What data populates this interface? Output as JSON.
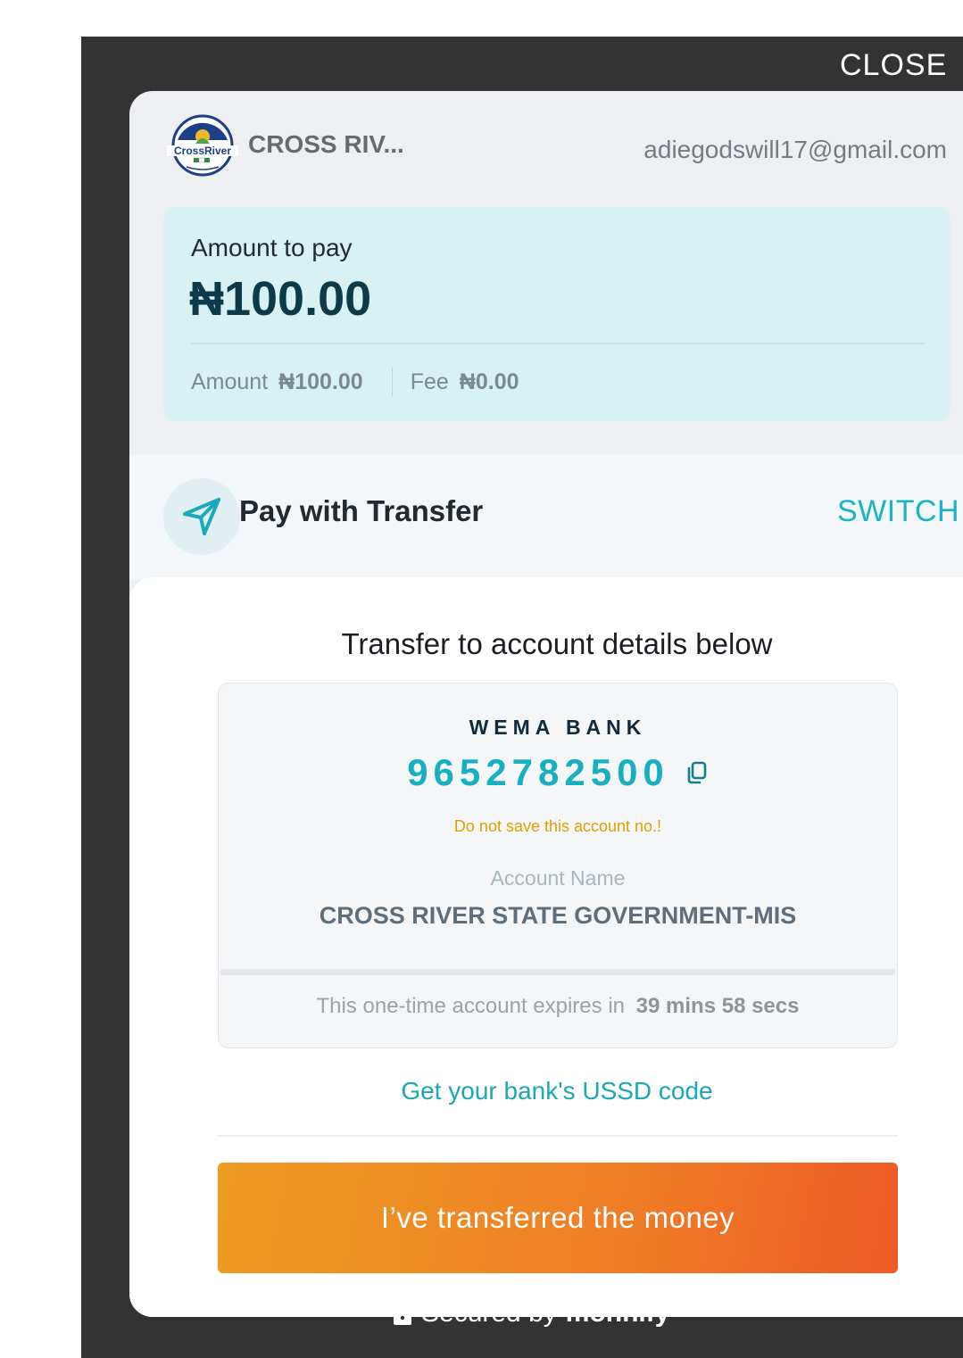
{
  "overlay": {
    "close_label": "CLOSE",
    "close_icon": "close-x-icon",
    "secured_prefix": "Secured by",
    "secured_brand": "monnify"
  },
  "header": {
    "merchant_name": "CROSS RIV...",
    "merchant_logo_text": "CrossRiver",
    "customer_email": "adiegodswill17@gmail.com"
  },
  "amount": {
    "label": "Amount to pay",
    "total": "₦100.00",
    "amount_label": "Amount",
    "amount_value": "₦100.00",
    "fee_label": "Fee",
    "fee_value": "₦0.00"
  },
  "method": {
    "icon": "send-icon",
    "title": "Pay with Transfer",
    "switch_label": "SWITCH"
  },
  "transfer": {
    "title": "Transfer to account details below",
    "bank_name": "WEMA BANK",
    "account_number": "9652782500",
    "copy_icon": "copy-icon",
    "warning": "Do not save this account no.!",
    "account_name_label": "Account Name",
    "account_name": "CROSS RIVER STATE GOVERNMENT-MIS",
    "expiry_text": "This one-time account expires in",
    "expiry_time": "39 mins 58 secs",
    "ussd_link": "Get your bank's USSD code",
    "confirm_button": "I’ve transferred the money"
  },
  "colors": {
    "accent": "#1ab4c3",
    "warning": "#e0a100",
    "button_start": "#ee9c22",
    "button_end": "#ee5a25",
    "amount_card_bg": "#d8f1f3",
    "overlay_bg": "#333333"
  }
}
